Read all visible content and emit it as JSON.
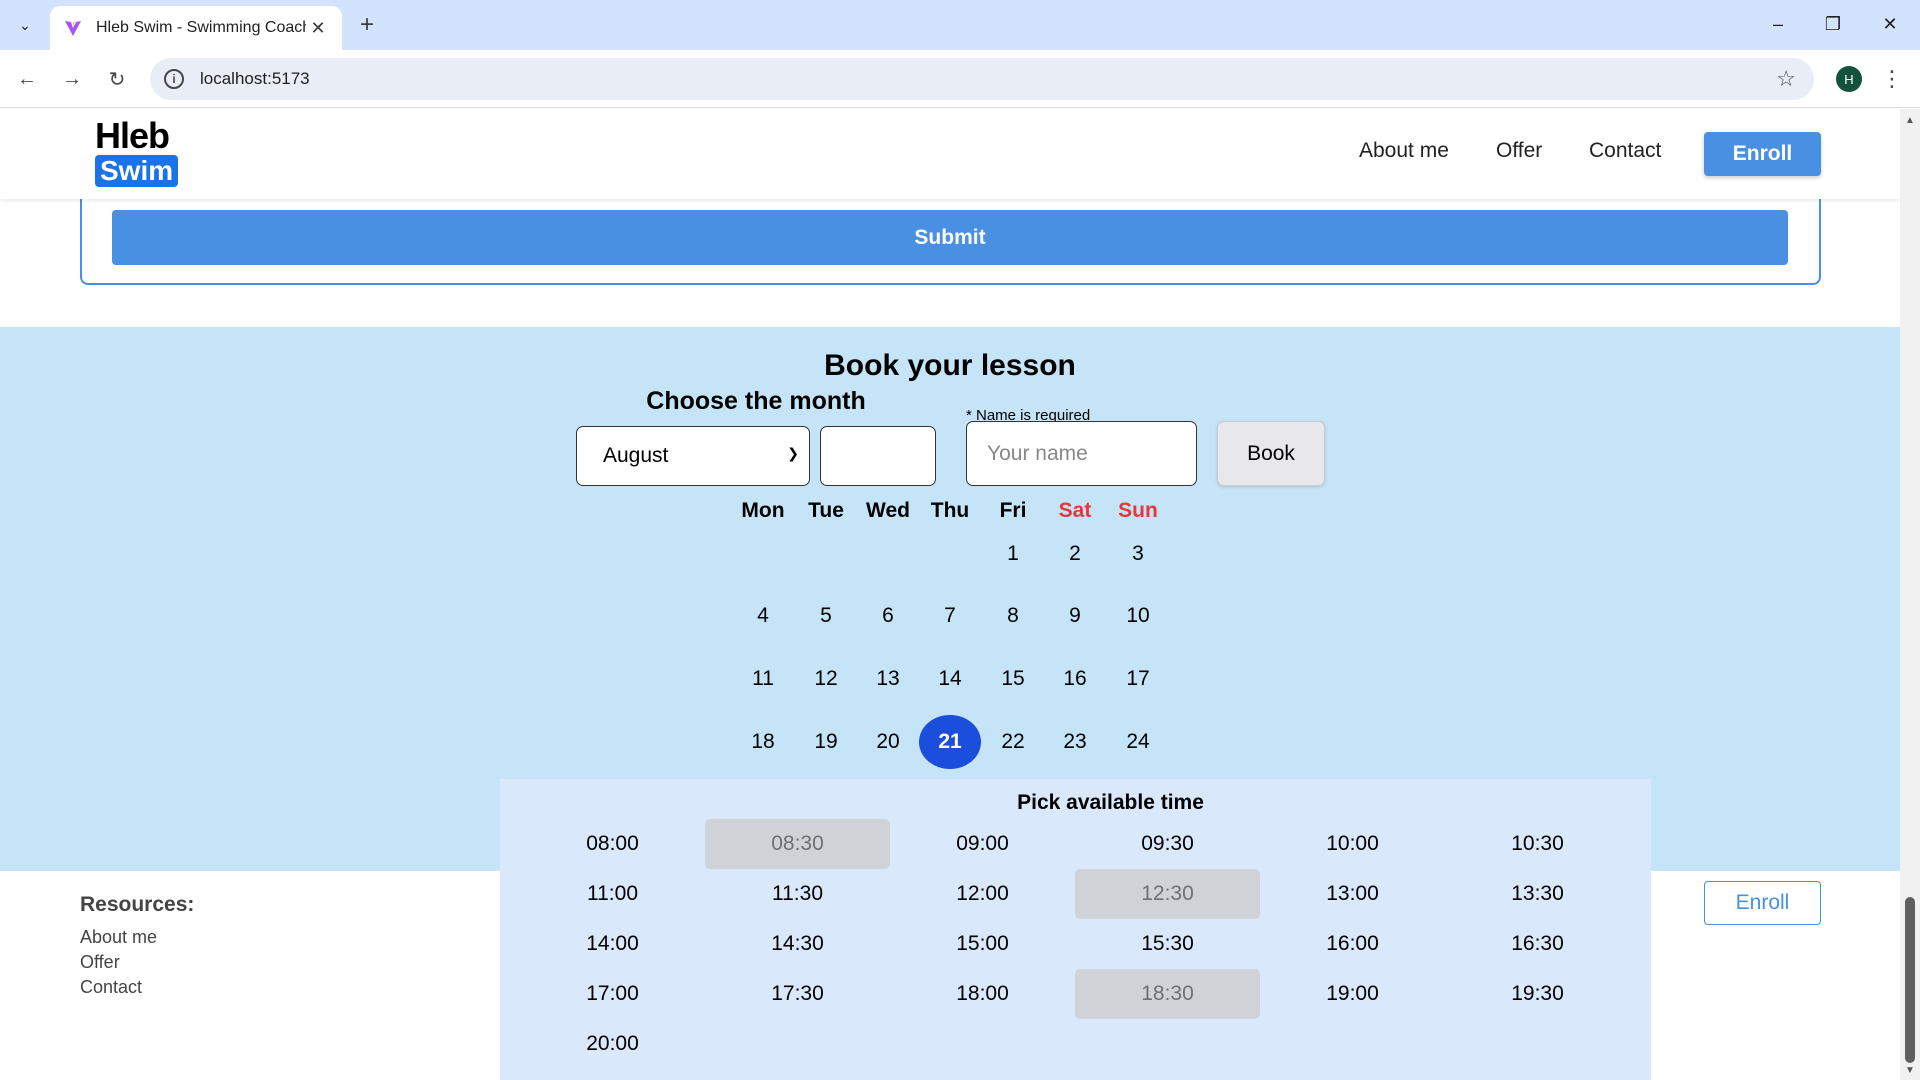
{
  "browser": {
    "tab_title": "Hleb Swim - Swimming Coach",
    "url": "localhost:5173",
    "profile_initial": "H"
  },
  "header": {
    "logo_top": "Hleb",
    "logo_bottom": "Swim",
    "nav": [
      "About me",
      "Offer",
      "Contact"
    ],
    "enroll_label": "Enroll"
  },
  "form": {
    "submit_label": "Submit"
  },
  "booking": {
    "title": "Book your lesson",
    "month_title": "Choose the month",
    "month_selected": "August",
    "year_value": "",
    "name_required": "* Name is required",
    "name_placeholder": "Your name",
    "book_label": "Book",
    "weekdays": [
      "Mon",
      "Tue",
      "Wed",
      "Thu",
      "Fri",
      "Sat",
      "Sun"
    ],
    "weekend_color": "#e5383b",
    "selected_day": "21",
    "selected_color": "#1b4fdb",
    "weeks": [
      [
        "",
        "",
        "",
        "",
        "1",
        "2",
        "3"
      ],
      [
        "4",
        "5",
        "6",
        "7",
        "8",
        "9",
        "10"
      ],
      [
        "11",
        "12",
        "13",
        "14",
        "15",
        "16",
        "17"
      ],
      [
        "18",
        "19",
        "20",
        "21",
        "22",
        "23",
        "24"
      ]
    ]
  },
  "timepicker": {
    "title": "Pick available time",
    "slots": [
      {
        "time": "08:00",
        "available": true
      },
      {
        "time": "08:30",
        "available": false
      },
      {
        "time": "09:00",
        "available": true
      },
      {
        "time": "09:30",
        "available": true
      },
      {
        "time": "10:00",
        "available": true
      },
      {
        "time": "10:30",
        "available": true
      },
      {
        "time": "11:00",
        "available": true
      },
      {
        "time": "11:30",
        "available": true
      },
      {
        "time": "12:00",
        "available": true
      },
      {
        "time": "12:30",
        "available": false
      },
      {
        "time": "13:00",
        "available": true
      },
      {
        "time": "13:30",
        "available": true
      },
      {
        "time": "14:00",
        "available": true
      },
      {
        "time": "14:30",
        "available": true
      },
      {
        "time": "15:00",
        "available": true
      },
      {
        "time": "15:30",
        "available": true
      },
      {
        "time": "16:00",
        "available": true
      },
      {
        "time": "16:30",
        "available": true
      },
      {
        "time": "17:00",
        "available": true
      },
      {
        "time": "17:30",
        "available": true
      },
      {
        "time": "18:00",
        "available": true
      },
      {
        "time": "18:30",
        "available": false
      },
      {
        "time": "19:00",
        "available": true
      },
      {
        "time": "19:30",
        "available": true
      },
      {
        "time": "20:00",
        "available": true
      }
    ]
  },
  "footer": {
    "resources_title": "Resources:",
    "links": [
      "About me",
      "Offer",
      "Contact"
    ],
    "enroll_label": "Enroll"
  }
}
